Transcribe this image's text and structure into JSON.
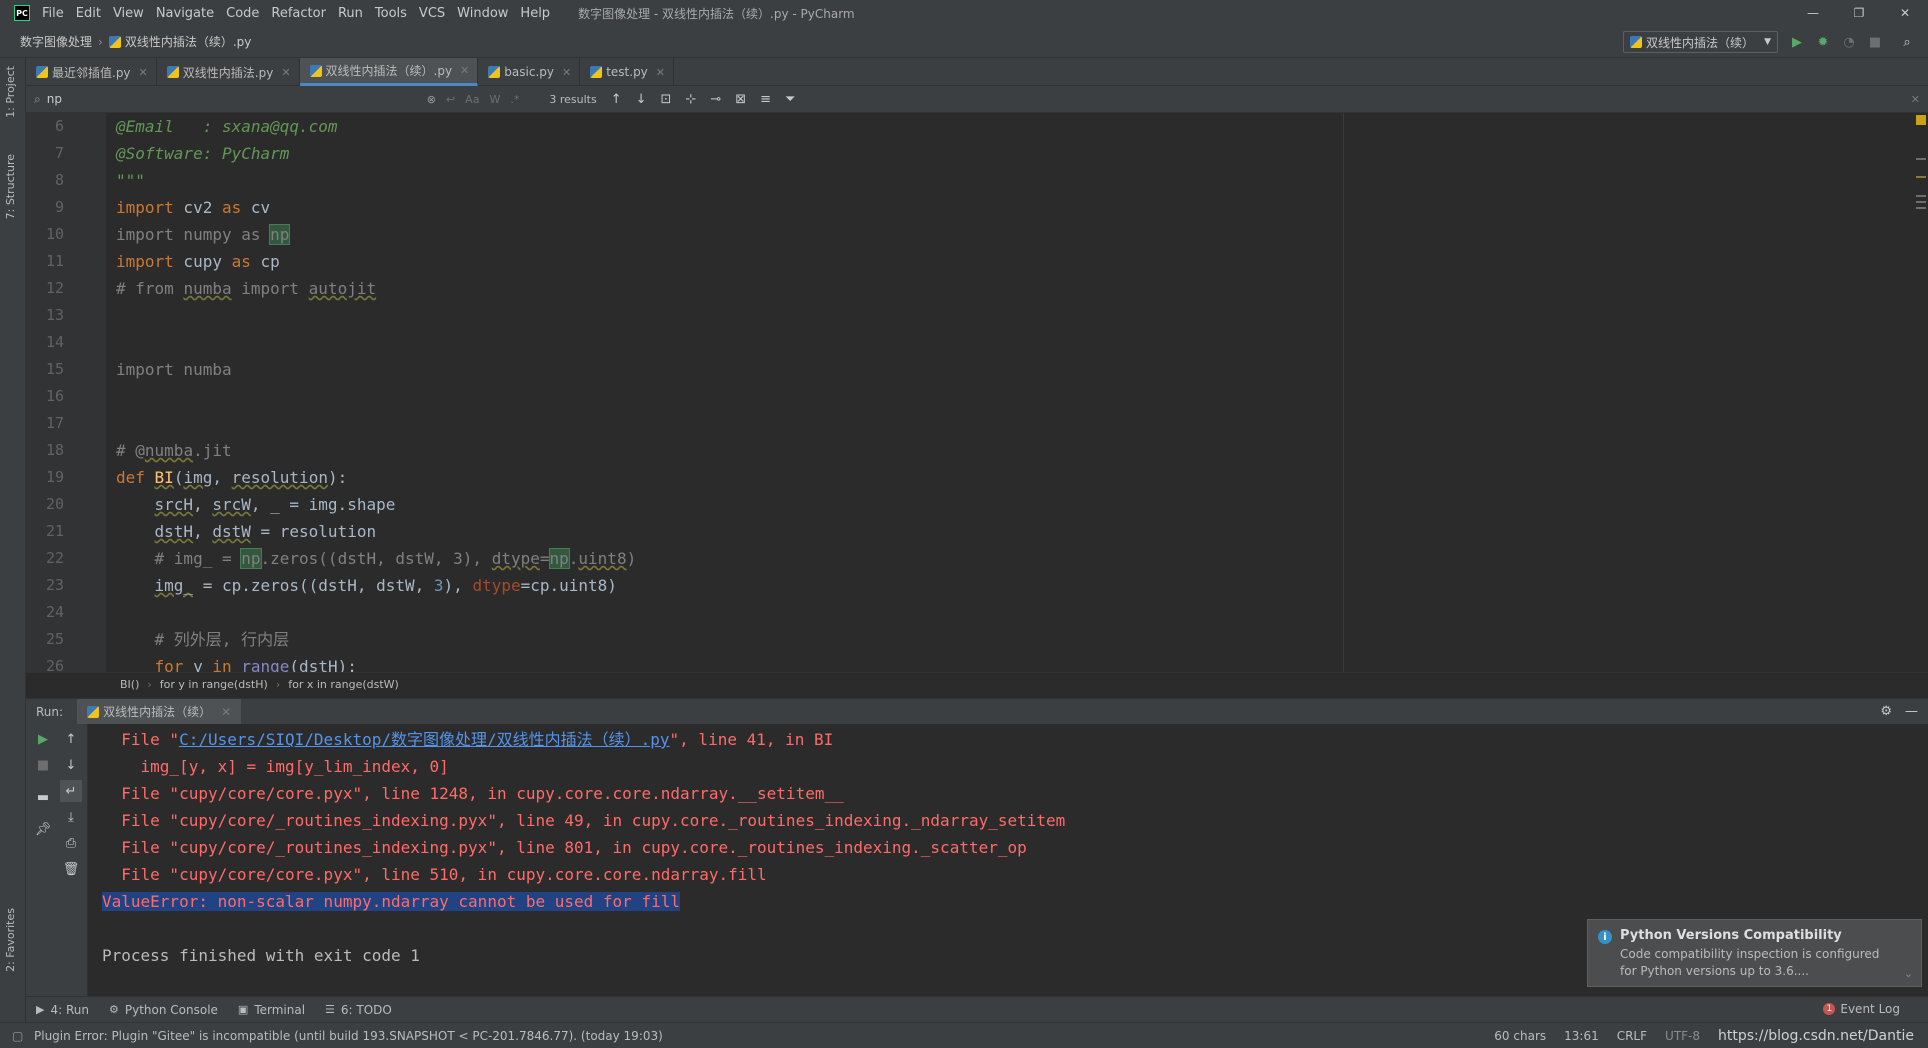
{
  "window": {
    "title": "数字图像处理 - 双线性内插法（续）.py - PyCharm",
    "menu": [
      "File",
      "Edit",
      "View",
      "Navigate",
      "Code",
      "Refactor",
      "Run",
      "Tools",
      "VCS",
      "Window",
      "Help"
    ],
    "logo": "PC"
  },
  "navbar": {
    "project": "数字图像处理",
    "file": "双线性内插法（续）.py",
    "run_config": "双线性内插法（续）"
  },
  "left_tools": {
    "project": "1: Project",
    "structure": "7: Structure",
    "favorites": "2: Favorites"
  },
  "tabs": [
    {
      "label": "最近邻插值.py"
    },
    {
      "label": "双线性内插法.py"
    },
    {
      "label": "双线性内插法（续）.py"
    },
    {
      "label": "basic.py"
    },
    {
      "label": "test.py"
    }
  ],
  "search": {
    "query": "np",
    "results": "3 results",
    "opt_case": "Aa",
    "opt_word": "W",
    "opt_regex": ".*"
  },
  "editor": {
    "line_numbers": [
      "6",
      "7",
      "8",
      "9",
      "10",
      "11",
      "12",
      "13",
      "14",
      "15",
      "16",
      "17",
      "18",
      "19",
      "20",
      "21",
      "22",
      "23",
      "24",
      "25",
      "26"
    ],
    "breadcrumbs": [
      "BI()",
      "for y in range(dstH)",
      "for x in range(dstW)"
    ]
  },
  "run": {
    "label": "Run:",
    "tab": "双线性内插法（续）",
    "traceback": [
      {
        "pre": "  File \"",
        "link": "C:/Users/SIQI/Desktop/数字图像处理/双线性内插法（续）.py",
        "post": "\", line 41, in BI"
      },
      {
        "text": "    img_[y, x] = img[y_lim_index, 0]"
      },
      {
        "text": "  File \"cupy/core/core.pyx\", line 1248, in cupy.core.core.ndarray.__setitem__"
      },
      {
        "text": "  File \"cupy/core/_routines_indexing.pyx\", line 49, in cupy.core._routines_indexing._ndarray_setitem"
      },
      {
        "text": "  File \"cupy/core/_routines_indexing.pyx\", line 801, in cupy.core._routines_indexing._scatter_op"
      },
      {
        "text": "  File \"cupy/core/core.pyx\", line 510, in cupy.core.core.ndarray.fill"
      }
    ],
    "error": "ValueError: non-scalar numpy.ndarray cannot be used for fill",
    "finished": "Process finished with exit code 1"
  },
  "notification": {
    "title": "Python Versions Compatibility",
    "line1": "Code compatibility inspection is configured",
    "line2": "for Python versions up to 3.6...."
  },
  "bottom_tools": {
    "run": "4: Run",
    "console": "Python Console",
    "terminal": "Terminal",
    "todo": "6: TODO",
    "event_log": "Event Log",
    "event_badge": "1"
  },
  "status": {
    "message": "Plugin Error: Plugin \"Gitee\" is incompatible (until build 193.SNAPSHOT < PC-201.7846.77). (today 19:03)",
    "chars": "60 chars",
    "position": "13:61",
    "line_sep": "CRLF",
    "encoding": "UTF-8",
    "url": "https://blog.csdn.net/Dantie"
  },
  "colors": {
    "accent": "#4a88c7",
    "error": "#ff6b68",
    "docstring": "#629755",
    "keyword": "#cc7832"
  }
}
